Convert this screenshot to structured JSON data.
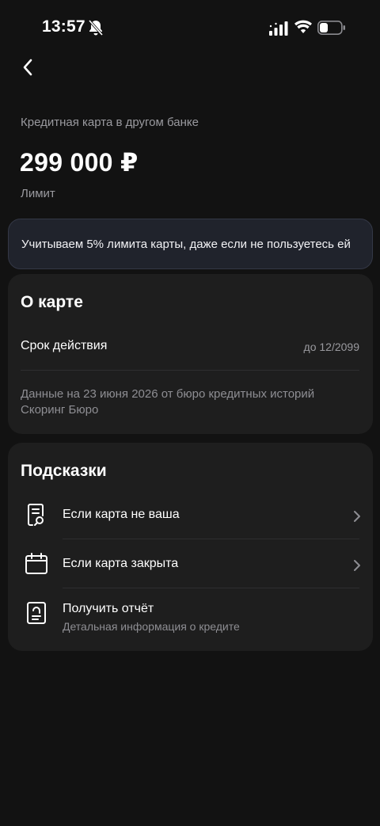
{
  "status_bar": {
    "time": "13:57",
    "icons": [
      "bell-slash-icon",
      "signal-icon",
      "wifi-icon",
      "battery-icon"
    ]
  },
  "header": {
    "back_icon": "chevron-left-icon",
    "subtitle": "Кредитная карта в другом банке",
    "amount": "299 000 ₽",
    "amount_label": "Лимит"
  },
  "banner": {
    "text": "Учитываем 5% лимита карты, даже если не пользуетесь ей"
  },
  "about": {
    "title": "О карте",
    "validity_label": "Срок действия",
    "validity_value": "до 12/2099",
    "data_note": "Данные на 23 июня 2026 от бюро кредитных историй Скоринг Бюро"
  },
  "tips": {
    "title": "Подсказки",
    "items": [
      {
        "label": "Если карта не ваша",
        "icon": "document-search-icon"
      },
      {
        "label": "Если карта закрыта",
        "icon": "calendar-icon"
      },
      {
        "label": "Получить отчёт",
        "sub": "Детальная информация о кредите",
        "icon": "report-icon"
      }
    ]
  },
  "colors": {
    "background": "#121212",
    "card": "#1e1e1e",
    "banner": "#20232c",
    "text_secondary": "#9a9a9f"
  }
}
